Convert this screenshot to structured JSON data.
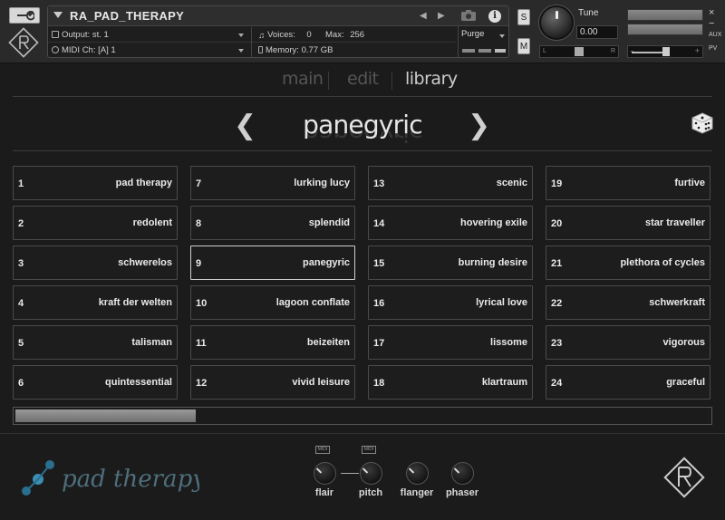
{
  "host": {
    "instrument_name": "RA_PAD_THERAPY",
    "output_label": "Output:",
    "output_value": "st. 1",
    "voices_label": "Voices:",
    "voices_value": "0",
    "max_label": "Max:",
    "max_value": "256",
    "midi_label": "MIDI Ch:",
    "midi_value": "[A]  1",
    "memory_label": "Memory:",
    "memory_value": "0.77 GB",
    "purge_label": "Purge",
    "solo_label": "S",
    "mute_label": "M",
    "tune_label": "Tune",
    "tune_value": "0.00",
    "pan_left": "L",
    "pan_right": "R",
    "aux_label": "AUX",
    "pv_label": "PV",
    "vol_minus": "−",
    "vol_plus": "+",
    "info_label": "i"
  },
  "tabs": [
    {
      "label": "main",
      "active": false
    },
    {
      "label": "edit",
      "active": false
    },
    {
      "label": "library",
      "active": true
    }
  ],
  "preset": {
    "current": "panegyric"
  },
  "presets": [
    {
      "num": "1",
      "name": "pad therapy"
    },
    {
      "num": "2",
      "name": "redolent"
    },
    {
      "num": "3",
      "name": "schwerelos"
    },
    {
      "num": "4",
      "name": "kraft der welten"
    },
    {
      "num": "5",
      "name": "talisman"
    },
    {
      "num": "6",
      "name": "quintessential"
    },
    {
      "num": "7",
      "name": "lurking lucy"
    },
    {
      "num": "8",
      "name": "splendid"
    },
    {
      "num": "9",
      "name": "panegyric"
    },
    {
      "num": "10",
      "name": "lagoon conflate"
    },
    {
      "num": "11",
      "name": "beizeiten"
    },
    {
      "num": "12",
      "name": "vivid leisure"
    },
    {
      "num": "13",
      "name": "scenic"
    },
    {
      "num": "14",
      "name": "hovering exile"
    },
    {
      "num": "15",
      "name": "burning desire"
    },
    {
      "num": "16",
      "name": "lyrical love"
    },
    {
      "num": "17",
      "name": "lissome"
    },
    {
      "num": "18",
      "name": "klartraum"
    },
    {
      "num": "19",
      "name": "furtive"
    },
    {
      "num": "20",
      "name": "star traveller"
    },
    {
      "num": "21",
      "name": "plethora of cycles"
    },
    {
      "num": "22",
      "name": "schwerkraft"
    },
    {
      "num": "23",
      "name": "vigorous"
    },
    {
      "num": "24",
      "name": "graceful"
    }
  ],
  "selected_preset": "9",
  "scroll_position": 0.26,
  "footer": {
    "brand_text": "pad therapy",
    "midi_tag": "MIDI",
    "knobs": [
      {
        "label": "flair",
        "midi": true
      },
      {
        "label": "pitch",
        "midi": true
      },
      {
        "label": "flanger",
        "midi": false
      },
      {
        "label": "phaser",
        "midi": false
      }
    ]
  },
  "colors": {
    "background": "#1b1b1b",
    "text": "#eaeaea",
    "selected_border": "#cfcfcf",
    "brand_accent": "#5a7a8a"
  }
}
